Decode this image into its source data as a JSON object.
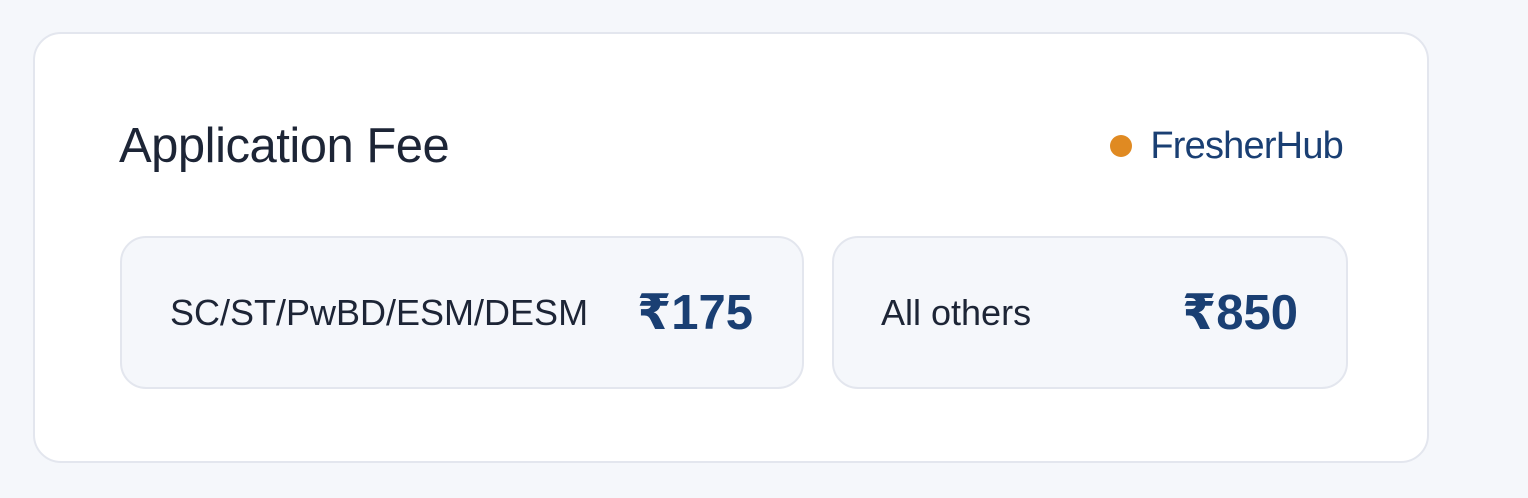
{
  "card": {
    "title": "Application Fee",
    "brand": "FresherHub"
  },
  "fees": [
    {
      "category": "SC/ST/PwBD/ESM/DESM",
      "amount": "₹175"
    },
    {
      "category": "All others",
      "amount": "₹850"
    }
  ],
  "colors": {
    "page_background": "#f5f7fb",
    "card_background": "#ffffff",
    "title_text": "#1d2536",
    "brand_text": "#1a3f73",
    "brand_dot": "#e08a22",
    "amount_text": "#1a3f73",
    "fee_box_background": "#f5f7fb"
  }
}
